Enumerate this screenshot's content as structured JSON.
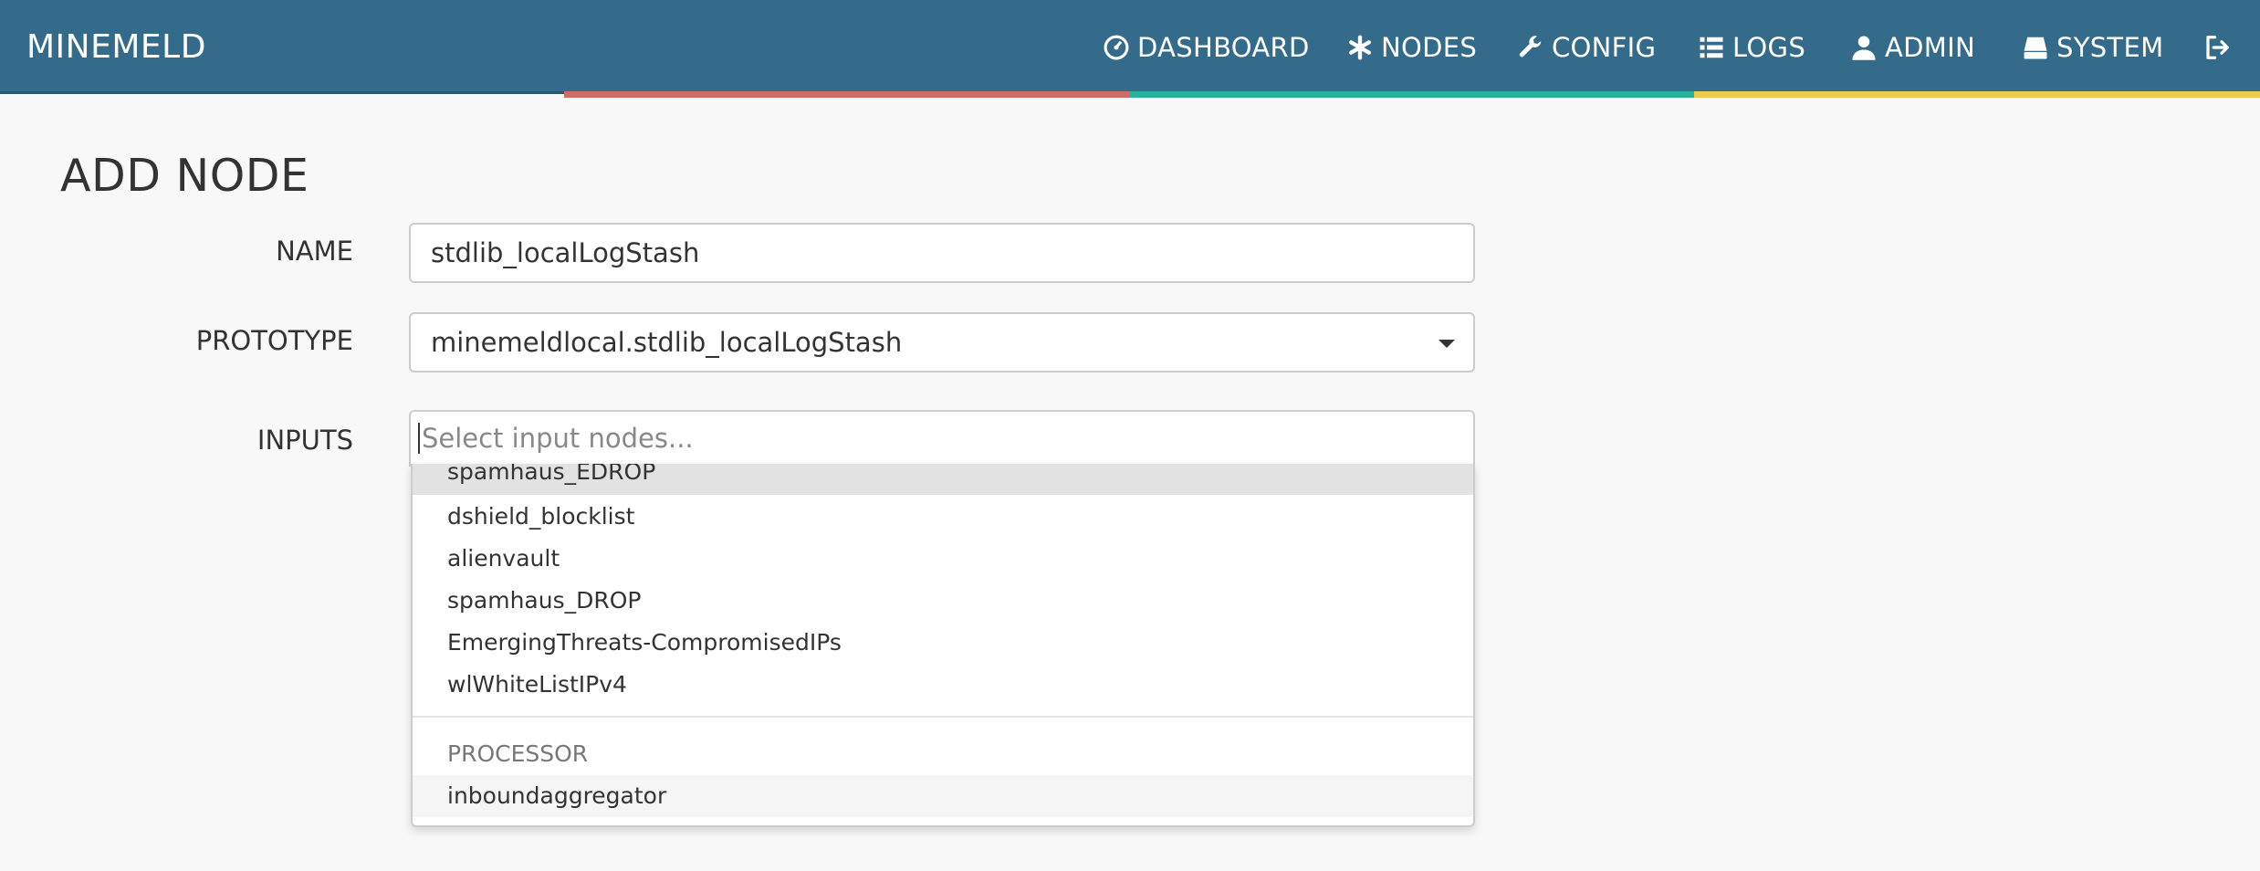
{
  "app": {
    "brand": "MINEMELD"
  },
  "nav": {
    "items": [
      {
        "label": "DASHBOARD",
        "icon": "dashboard-icon"
      },
      {
        "label": "NODES",
        "icon": "asterisk-icon"
      },
      {
        "label": "CONFIG",
        "icon": "wrench-icon"
      },
      {
        "label": "LOGS",
        "icon": "list-icon"
      },
      {
        "label": "ADMIN",
        "icon": "user-icon"
      },
      {
        "label": "SYSTEM",
        "icon": "hdd-icon"
      }
    ],
    "logout_icon": "logout-icon",
    "stripe_colors": [
      "#cf6d63",
      "#27b29d",
      "#eec94a"
    ]
  },
  "page": {
    "title": "ADD NODE"
  },
  "form": {
    "name_label": "NAME",
    "name_value": "stdlib_localLogStash",
    "prototype_label": "PROTOTYPE",
    "prototype_value": "minemeldlocal.stdlib_localLogStash",
    "inputs_label": "INPUTS",
    "inputs_placeholder": "Select input nodes..."
  },
  "dropdown": {
    "options": [
      "spamhaus_EDROP",
      "dshield_blocklist",
      "alienvault",
      "spamhaus_DROP",
      "EmergingThreats-CompromisedIPs",
      "wlWhiteListIPv4"
    ],
    "group_header": "PROCESSOR",
    "group_options": [
      "inboundaggregator"
    ]
  },
  "colors": {
    "navbar": "#346b8a",
    "background": "#f8f8f8"
  }
}
